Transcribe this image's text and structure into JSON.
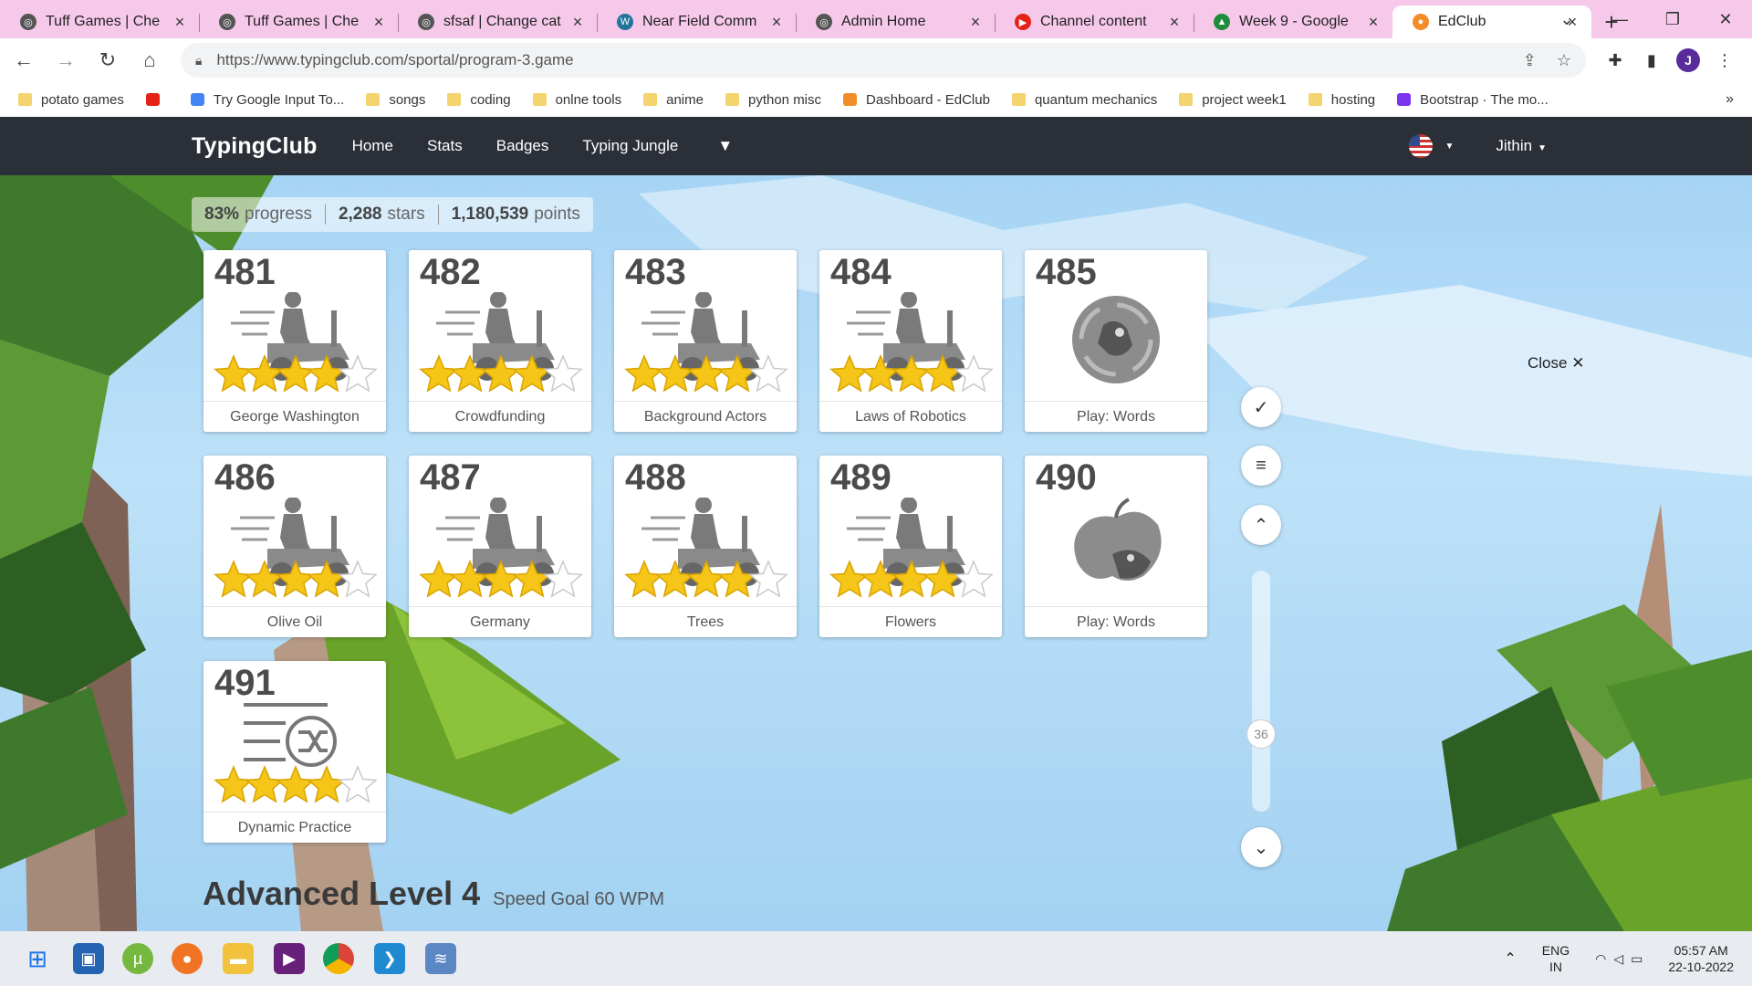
{
  "browser": {
    "tabs": [
      {
        "title": "Tuff Games | Che",
        "favicon": "globe-icon",
        "active": false
      },
      {
        "title": "Tuff Games | Che",
        "favicon": "globe-icon",
        "active": false
      },
      {
        "title": "sfsaf | Change cat",
        "favicon": "globe-icon",
        "active": false
      },
      {
        "title": "Near Field Comm",
        "favicon": "wordpress-icon",
        "active": false
      },
      {
        "title": "Admin Home",
        "favicon": "globe-icon",
        "active": false
      },
      {
        "title": "Channel content",
        "favicon": "youtube-icon",
        "active": false
      },
      {
        "title": "Week 9 - Google",
        "favicon": "google-drive-icon",
        "active": false
      },
      {
        "title": "EdClub",
        "favicon": "edclub-icon",
        "active": true
      }
    ],
    "url": "https://www.typingclub.com/sportal/program-3.game",
    "profile_initial": "J",
    "bookmarks": [
      {
        "label": "potato games",
        "icon": "folder-icon"
      },
      {
        "label": "",
        "icon": "youtube-icon"
      },
      {
        "label": "Try Google Input To...",
        "icon": "google-icon"
      },
      {
        "label": "songs",
        "icon": "folder-icon"
      },
      {
        "label": "coding",
        "icon": "folder-icon"
      },
      {
        "label": "onlne tools",
        "icon": "folder-icon"
      },
      {
        "label": "anime",
        "icon": "folder-icon"
      },
      {
        "label": "python misc",
        "icon": "folder-icon"
      },
      {
        "label": "Dashboard - EdClub",
        "icon": "edclub-icon"
      },
      {
        "label": "quantum mechanics",
        "icon": "folder-icon"
      },
      {
        "label": "project week1",
        "icon": "folder-icon"
      },
      {
        "label": "hosting",
        "icon": "folder-icon"
      },
      {
        "label": "Bootstrap · The mo...",
        "icon": "bootstrap-icon"
      }
    ],
    "more_bookmarks": "»"
  },
  "site": {
    "brand": "TypingClub",
    "nav": [
      "Home",
      "Stats",
      "Badges",
      "Typing Jungle"
    ],
    "user": "Jithin"
  },
  "stats": {
    "progress_value": "83%",
    "progress_label": "progress",
    "stars_value": "2,288",
    "stars_label": "stars",
    "points_value": "1,180,539",
    "points_label": "points"
  },
  "lessons": [
    {
      "num": "481",
      "label": "George Washington",
      "type": "scooter",
      "stars": 4
    },
    {
      "num": "482",
      "label": "Crowdfunding",
      "type": "scooter",
      "stars": 4
    },
    {
      "num": "483",
      "label": "Background Actors",
      "type": "scooter",
      "stars": 4
    },
    {
      "num": "484",
      "label": "Laws of Robotics",
      "type": "scooter",
      "stars": 4
    },
    {
      "num": "485",
      "label": "Play: Words",
      "type": "game-disc",
      "stars": 0
    },
    {
      "num": "486",
      "label": "Olive Oil",
      "type": "scooter",
      "stars": 4
    },
    {
      "num": "487",
      "label": "Germany",
      "type": "scooter",
      "stars": 4
    },
    {
      "num": "488",
      "label": "Trees",
      "type": "scooter",
      "stars": 4
    },
    {
      "num": "489",
      "label": "Flowers",
      "type": "scooter",
      "stars": 4
    },
    {
      "num": "490",
      "label": "Play: Words",
      "type": "game-apple",
      "stars": 0
    },
    {
      "num": "491",
      "label": "Dynamic Practice",
      "type": "shuffle",
      "stars": 4
    }
  ],
  "close_label": "Close",
  "scroll_indicator": "36",
  "next_level": {
    "title": "Advanced Level 4",
    "subtitle": "Speed Goal 60 WPM"
  },
  "taskbar": {
    "lang_top": "ENG",
    "lang_bottom": "IN",
    "time": "05:57 AM",
    "date": "22-10-2022"
  },
  "colors": {
    "tabstrip": "#f6c9ea",
    "navbar": "#2b2f37",
    "star": "#f5c518",
    "sky": "#a9d6f5"
  }
}
